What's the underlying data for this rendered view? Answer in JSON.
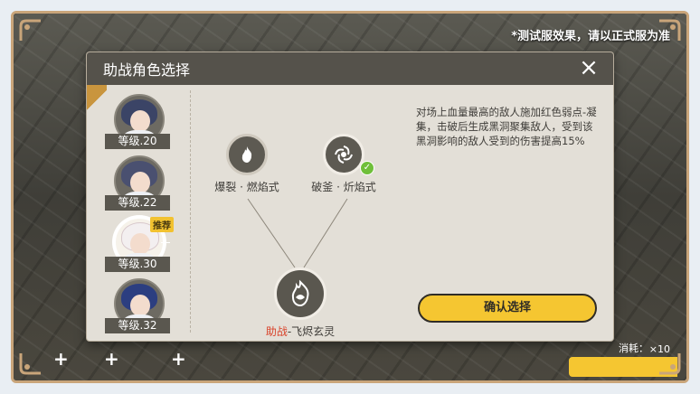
{
  "notice": "*测试服效果，请以正式服为准",
  "modal": {
    "title": "助战角色选择",
    "close_icon": "×"
  },
  "characters": [
    {
      "level": "等级.20",
      "hair": "#3b4466",
      "selected": false
    },
    {
      "level": "等级.22",
      "hair": "#4a5070",
      "selected": false
    },
    {
      "level": "等级.30",
      "hair": "#f3eff0",
      "selected": true,
      "badge": "推荐"
    },
    {
      "level": "等级.32",
      "hair": "#2c3e80",
      "selected": false
    }
  ],
  "skills": {
    "left": {
      "label": "爆裂 · 燃焰式",
      "icon": "flame-burst-icon"
    },
    "right": {
      "label": "破釜 · 炘焰式",
      "icon": "vortex-icon",
      "checked": true
    },
    "root": {
      "label_highlight": "助战",
      "label_rest": "-飞烬玄灵",
      "icon": "spirit-flame-icon"
    }
  },
  "description": "对场上血量最高的敌人施加红色弱点-凝集，击破后生成黑洞聚集敌人，受到该黑洞影响的敌人受到的伤害提高15%",
  "confirm_label": "确认选择",
  "hud": {
    "cost_label": "消耗：",
    "cost_count": "×10"
  },
  "colors": {
    "accent": "#f5c631",
    "highlight_red": "#d9432b",
    "check_green": "#6fbf3a"
  }
}
